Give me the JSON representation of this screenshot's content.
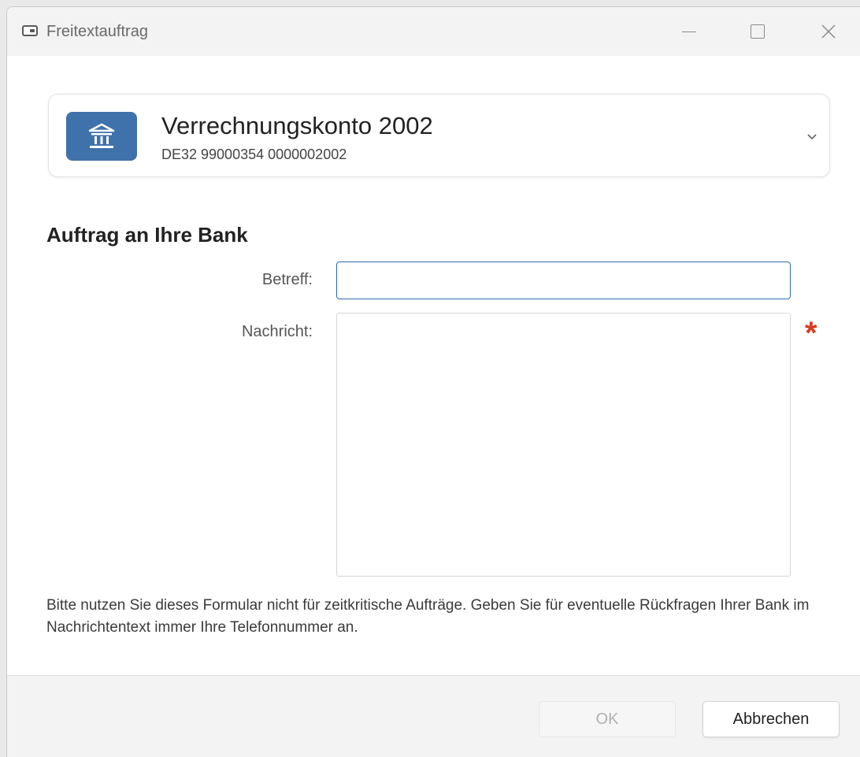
{
  "window": {
    "title": "Freitextauftrag",
    "icon": "window-icon",
    "controls": [
      "minimize-icon",
      "maximize-icon",
      "close-icon"
    ]
  },
  "account": {
    "name": "Verrechnungskonto 2002",
    "iban": "DE32 99000354 0000002002",
    "icon": "bank-icon",
    "badge_color": "#3f72aa"
  },
  "form": {
    "section_title": "Auftrag an Ihre Bank",
    "subject_label": "Betreff:",
    "subject_value": "",
    "message_label": "Nachricht:",
    "message_value": "",
    "required_marker": "*",
    "required_color": "#d83b1c",
    "hint": "Bitte nutzen Sie dieses Formular nicht für zeitkritische Aufträge. Geben Sie für eventuelle Rückfragen Ihrer Bank im Nachrichtentext immer Ihre Telefonnummer an."
  },
  "footer": {
    "ok_label": "OK",
    "ok_enabled": false,
    "cancel_label": "Abbrechen"
  },
  "colors": {
    "accent": "#2e6ab0"
  }
}
